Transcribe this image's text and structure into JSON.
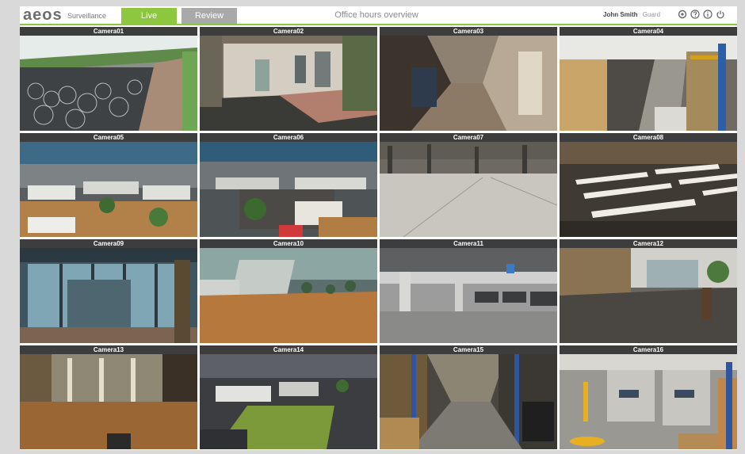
{
  "header": {
    "logo": "aeos",
    "logo_sub": "Surveillance",
    "tabs": [
      {
        "label": "Live",
        "active": true
      },
      {
        "label": "Review",
        "active": false
      }
    ],
    "title": "Office hours overview",
    "user_name": "John Smith",
    "user_role": "Guard",
    "icons": [
      "settings-icon",
      "help-icon",
      "info-icon",
      "power-icon"
    ]
  },
  "cameras": [
    {
      "label": "Camera01"
    },
    {
      "label": "Camera02"
    },
    {
      "label": "Camera03"
    },
    {
      "label": "Camera04"
    },
    {
      "label": "Camera05"
    },
    {
      "label": "Camera06"
    },
    {
      "label": "Camera07"
    },
    {
      "label": "Camera08"
    },
    {
      "label": "Camera09"
    },
    {
      "label": "Camera10"
    },
    {
      "label": "Camera11"
    },
    {
      "label": "Camera12"
    },
    {
      "label": "Camera13"
    },
    {
      "label": "Camera14"
    },
    {
      "label": "Camera15"
    },
    {
      "label": "Camera16"
    }
  ],
  "colors": {
    "accent": "#8dc63f",
    "inactive_tab": "#a9a9a9"
  }
}
